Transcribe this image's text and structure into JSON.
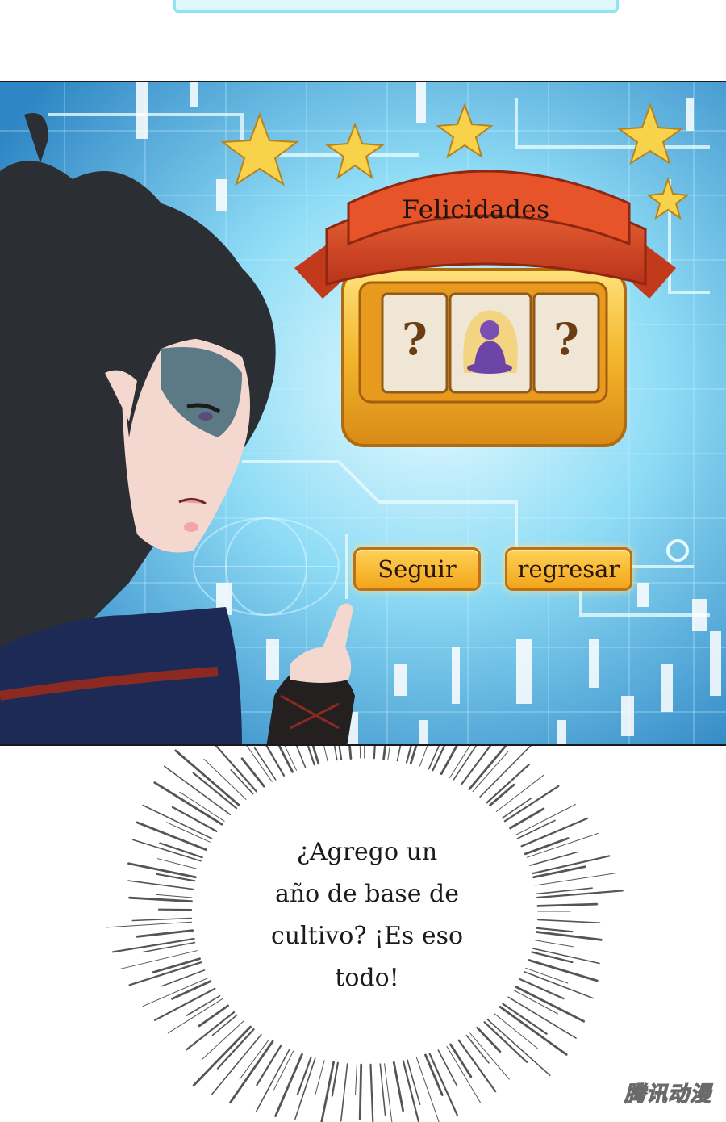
{
  "panel": {
    "banner_title": "Felicidades",
    "slots": [
      {
        "symbol": "?",
        "kind": "unknown"
      },
      {
        "symbol": "buddha-statue-icon",
        "kind": "revealed"
      },
      {
        "symbol": "?",
        "kind": "unknown"
      }
    ],
    "continue_label": "Seguir",
    "back_label": "regresar"
  },
  "dialogue": {
    "lines": [
      "¿Agrego un",
      "año de base de",
      "cultivo? ¡Es eso",
      "todo!"
    ]
  },
  "watermark": {
    "text": "腾讯动漫"
  },
  "colors": {
    "screen_blue": "#5fc3ec",
    "banner_red": "#d8451f",
    "slot_gold": "#f4b52c",
    "button_gold": "#f6b833",
    "star_yellow": "#f7d24a",
    "hair_dark": "#2b2f33",
    "robe_navy": "#1d2a55"
  }
}
